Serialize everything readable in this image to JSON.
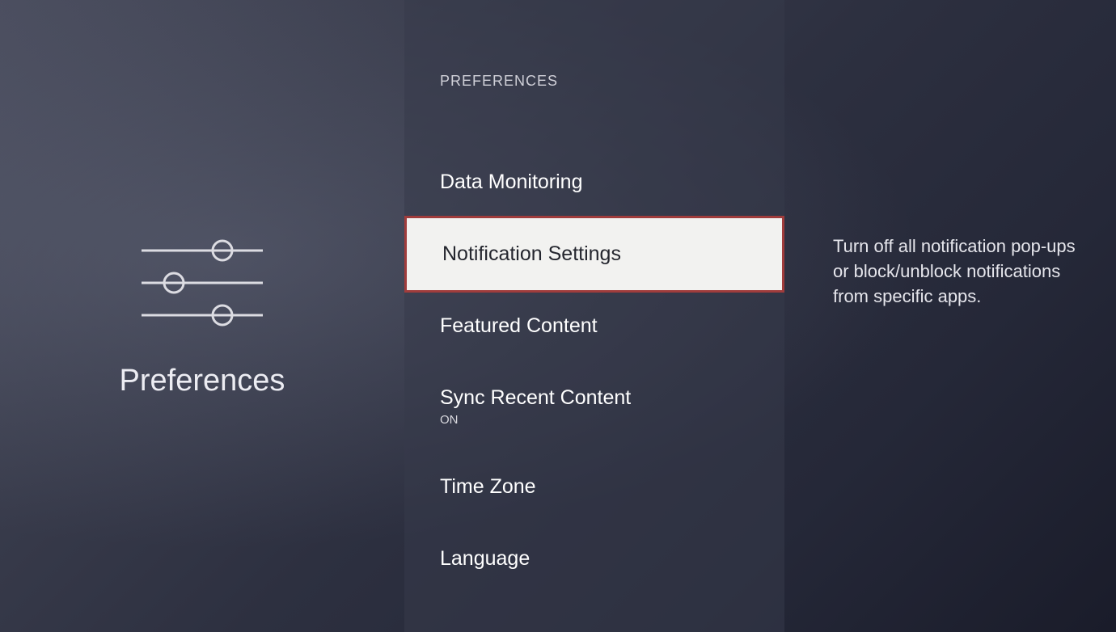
{
  "left": {
    "title": "Preferences"
  },
  "middle": {
    "header": "PREFERENCES",
    "items": [
      {
        "label": "Data Monitoring"
      },
      {
        "label": "Notification Settings",
        "selected": true
      },
      {
        "label": "Featured Content"
      },
      {
        "label": "Sync Recent Content",
        "sub": "ON"
      },
      {
        "label": "Time Zone"
      },
      {
        "label": "Language"
      }
    ]
  },
  "right": {
    "description": "Turn off all notification pop-ups or block/unblock notifications from specific apps."
  }
}
